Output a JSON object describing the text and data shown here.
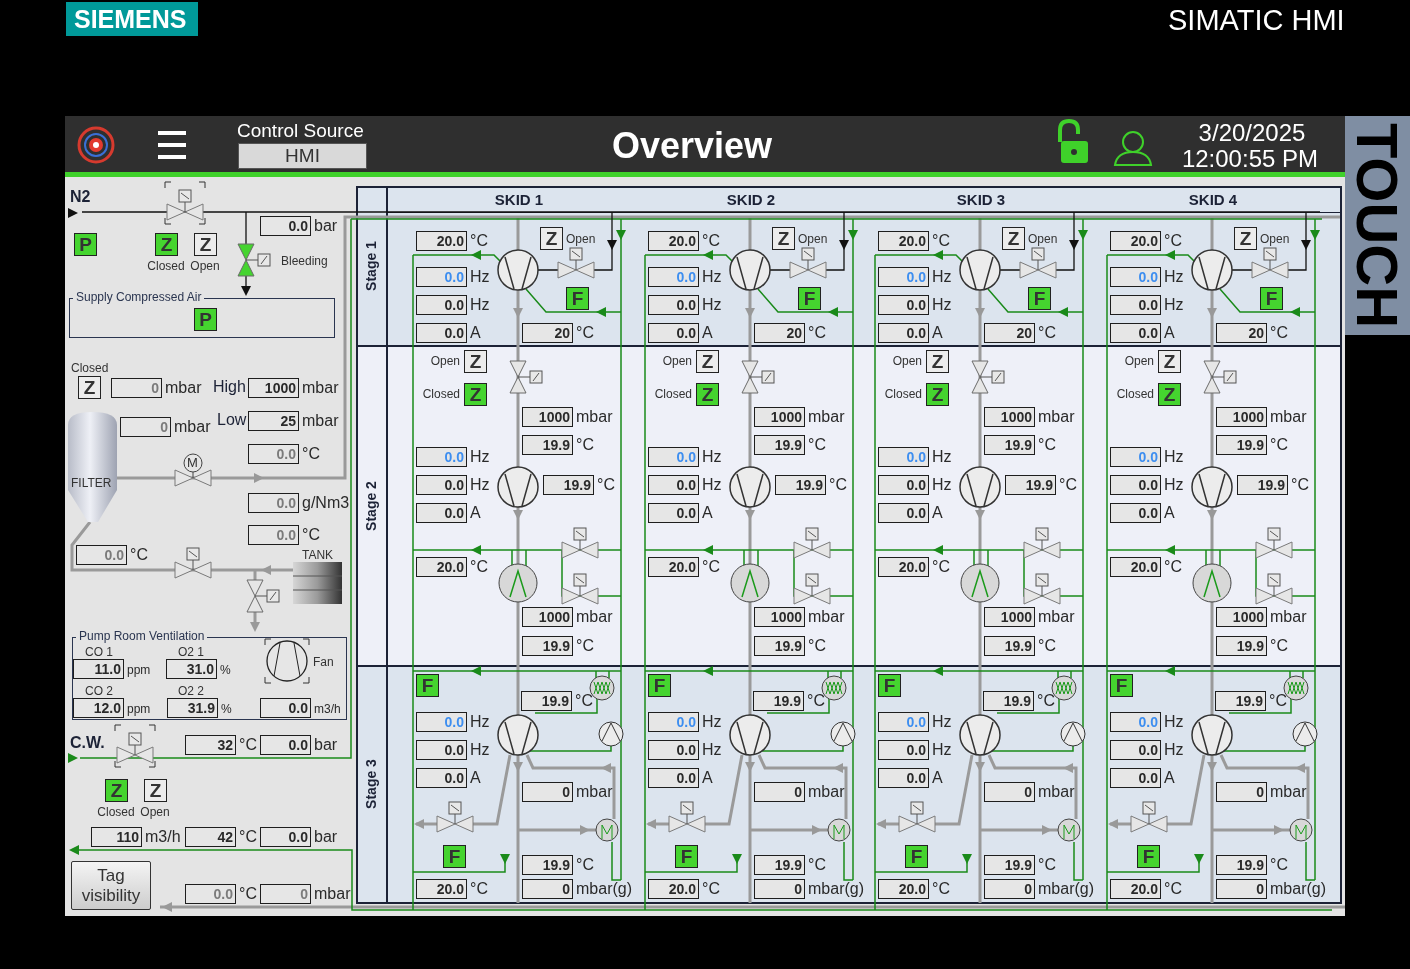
{
  "header": {
    "brand": "SIEMENS",
    "product": "SIMATIC HMI",
    "side_label": "TOUCH",
    "control_source_label": "Control Source",
    "control_source_value": "HMI",
    "title": "Overview",
    "date": "3/20/2025",
    "time": "12:00:55 PM"
  },
  "left_panel": [
    {
      "kind": "text",
      "text": "N2"
    },
    {
      "kind": "indicator",
      "letter": "P",
      "on": true
    },
    {
      "kind": "indicator",
      "letter": "Z",
      "on": true,
      "label": "Closed"
    },
    {
      "kind": "indicator",
      "letter": "Z",
      "on": false,
      "label": "Open"
    },
    {
      "kind": "field",
      "value": "0.0",
      "unit": "bar"
    },
    {
      "kind": "text",
      "text": "Bleeding"
    },
    {
      "kind": "group",
      "text": "Supply Compressed Air"
    },
    {
      "kind": "indicator",
      "letter": "P",
      "on": true
    },
    {
      "kind": "text",
      "text": "Closed"
    },
    {
      "kind": "indicator",
      "letter": "Z",
      "on": false
    },
    {
      "kind": "inactive",
      "value": "0",
      "unit": "mbar"
    },
    {
      "kind": "text",
      "text": "High"
    },
    {
      "kind": "field",
      "value": "1000",
      "unit": "mbar"
    },
    {
      "kind": "inactive",
      "value": "0",
      "unit": "mbar"
    },
    {
      "kind": "text",
      "text": "Low"
    },
    {
      "kind": "field",
      "value": "25",
      "unit": "mbar"
    },
    {
      "kind": "inactive",
      "value": "0.0",
      "unit": "°C"
    },
    {
      "kind": "text",
      "text": "M"
    },
    {
      "kind": "text",
      "text": "FILTER"
    },
    {
      "kind": "inactive",
      "value": "0.0",
      "unit": "g/Nm3"
    },
    {
      "kind": "inactive",
      "value": "0.0",
      "unit": "°C"
    },
    {
      "kind": "inactive",
      "value": "0.0",
      "unit": "°C"
    },
    {
      "kind": "text",
      "text": "TANK"
    },
    {
      "kind": "group",
      "text": "Pump Room Ventilation"
    },
    {
      "kind": "text",
      "text": "CO 1"
    },
    {
      "kind": "text",
      "text": "O2 1"
    },
    {
      "kind": "field",
      "value": "11.0",
      "unit": "ppm"
    },
    {
      "kind": "field",
      "value": "31.0",
      "unit": "%"
    },
    {
      "kind": "text",
      "text": "Fan"
    },
    {
      "kind": "text",
      "text": "CO 2"
    },
    {
      "kind": "text",
      "text": "O2 2"
    },
    {
      "kind": "field",
      "value": "12.0",
      "unit": "ppm"
    },
    {
      "kind": "field",
      "value": "31.9",
      "unit": "%"
    },
    {
      "kind": "field",
      "value": "0.0",
      "unit": "m3/h"
    },
    {
      "kind": "text",
      "text": "C.W."
    },
    {
      "kind": "field",
      "value": "32",
      "unit": "°C"
    },
    {
      "kind": "field",
      "value": "0.0",
      "unit": "bar"
    },
    {
      "kind": "indicator",
      "letter": "Z",
      "on": true,
      "label": "Closed"
    },
    {
      "kind": "indicator",
      "letter": "Z",
      "on": false,
      "label": "Open"
    },
    {
      "kind": "field",
      "value": "110",
      "unit": "m3/h"
    },
    {
      "kind": "field",
      "value": "42",
      "unit": "°C"
    },
    {
      "kind": "field",
      "value": "0.0",
      "unit": "bar"
    },
    {
      "kind": "button",
      "text": "Tag visibility"
    },
    {
      "kind": "inactive",
      "value": "0.0",
      "unit": "°C"
    },
    {
      "kind": "inactive",
      "value": "0",
      "unit": "mbar"
    }
  ],
  "bleeding_valve": {
    "on": true
  },
  "stages": [
    "Stage 1",
    "Stage 2",
    "Stage 3"
  ],
  "skids": [
    {
      "title": "SKID 1",
      "stage_1": [
        {
          "kind": "field",
          "value": "20.0",
          "unit": "°C"
        },
        {
          "kind": "indicator",
          "letter": "Z",
          "on": false,
          "label": "Open"
        },
        {
          "kind": "setpoint",
          "value": "0.0",
          "unit": "Hz"
        },
        {
          "kind": "field",
          "value": "0.0",
          "unit": "Hz"
        },
        {
          "kind": "indicator",
          "letter": "F",
          "on": true
        },
        {
          "kind": "field",
          "value": "0.0",
          "unit": "A"
        },
        {
          "kind": "field",
          "value": "20",
          "unit": "°C"
        }
      ],
      "stage_2": [
        {
          "kind": "indicator",
          "letter": "Z",
          "on": false,
          "label": "Open"
        },
        {
          "kind": "indicator",
          "letter": "Z",
          "on": true,
          "label": "Closed"
        },
        {
          "kind": "field",
          "value": "1000",
          "unit": "mbar"
        },
        {
          "kind": "field",
          "value": "19.9",
          "unit": "°C"
        },
        {
          "kind": "setpoint",
          "value": "0.0",
          "unit": "Hz"
        },
        {
          "kind": "field",
          "value": "0.0",
          "unit": "Hz"
        },
        {
          "kind": "field",
          "value": "0.0",
          "unit": "A"
        },
        {
          "kind": "field",
          "value": "19.9",
          "unit": "°C"
        },
        {
          "kind": "field",
          "value": "20.0",
          "unit": "°C"
        },
        {
          "kind": "field",
          "value": "1000",
          "unit": "mbar"
        },
        {
          "kind": "field",
          "value": "19.9",
          "unit": "°C"
        }
      ],
      "stage_3": [
        {
          "kind": "indicator",
          "letter": "F",
          "on": true
        },
        {
          "kind": "field",
          "value": "19.9",
          "unit": "°C"
        },
        {
          "kind": "setpoint",
          "value": "0.0",
          "unit": "Hz"
        },
        {
          "kind": "field",
          "value": "0.0",
          "unit": "Hz"
        },
        {
          "kind": "field",
          "value": "0.0",
          "unit": "A"
        },
        {
          "kind": "field",
          "value": "0",
          "unit": "mbar"
        },
        {
          "kind": "indicator",
          "letter": "F",
          "on": true
        },
        {
          "kind": "field",
          "value": "19.9",
          "unit": "°C"
        },
        {
          "kind": "field",
          "value": "20.0",
          "unit": "°C"
        },
        {
          "kind": "field",
          "value": "0",
          "unit": "mbar(g)"
        }
      ]
    },
    {
      "title": "SKID 2",
      "stage_1": [
        {
          "kind": "field",
          "value": "20.0",
          "unit": "°C"
        },
        {
          "kind": "indicator",
          "letter": "Z",
          "on": false,
          "label": "Open"
        },
        {
          "kind": "setpoint",
          "value": "0.0",
          "unit": "Hz"
        },
        {
          "kind": "field",
          "value": "0.0",
          "unit": "Hz"
        },
        {
          "kind": "indicator",
          "letter": "F",
          "on": true
        },
        {
          "kind": "field",
          "value": "0.0",
          "unit": "A"
        },
        {
          "kind": "field",
          "value": "20",
          "unit": "°C"
        }
      ],
      "stage_2": [
        {
          "kind": "indicator",
          "letter": "Z",
          "on": false,
          "label": "Open"
        },
        {
          "kind": "indicator",
          "letter": "Z",
          "on": true,
          "label": "Closed"
        },
        {
          "kind": "field",
          "value": "1000",
          "unit": "mbar"
        },
        {
          "kind": "field",
          "value": "19.9",
          "unit": "°C"
        },
        {
          "kind": "setpoint",
          "value": "0.0",
          "unit": "Hz"
        },
        {
          "kind": "field",
          "value": "0.0",
          "unit": "Hz"
        },
        {
          "kind": "field",
          "value": "0.0",
          "unit": "A"
        },
        {
          "kind": "field",
          "value": "19.9",
          "unit": "°C"
        },
        {
          "kind": "field",
          "value": "20.0",
          "unit": "°C"
        },
        {
          "kind": "field",
          "value": "1000",
          "unit": "mbar"
        },
        {
          "kind": "field",
          "value": "19.9",
          "unit": "°C"
        }
      ],
      "stage_3": [
        {
          "kind": "indicator",
          "letter": "F",
          "on": true
        },
        {
          "kind": "field",
          "value": "19.9",
          "unit": "°C"
        },
        {
          "kind": "setpoint",
          "value": "0.0",
          "unit": "Hz"
        },
        {
          "kind": "field",
          "value": "0.0",
          "unit": "Hz"
        },
        {
          "kind": "field",
          "value": "0.0",
          "unit": "A"
        },
        {
          "kind": "field",
          "value": "0",
          "unit": "mbar"
        },
        {
          "kind": "indicator",
          "letter": "F",
          "on": true
        },
        {
          "kind": "field",
          "value": "19.9",
          "unit": "°C"
        },
        {
          "kind": "field",
          "value": "20.0",
          "unit": "°C"
        },
        {
          "kind": "field",
          "value": "0",
          "unit": "mbar(g)"
        }
      ]
    },
    {
      "title": "SKID 3",
      "stage_1": [
        {
          "kind": "field",
          "value": "20.0",
          "unit": "°C"
        },
        {
          "kind": "indicator",
          "letter": "Z",
          "on": false,
          "label": "Open"
        },
        {
          "kind": "setpoint",
          "value": "0.0",
          "unit": "Hz"
        },
        {
          "kind": "field",
          "value": "0.0",
          "unit": "Hz"
        },
        {
          "kind": "indicator",
          "letter": "F",
          "on": true
        },
        {
          "kind": "field",
          "value": "0.0",
          "unit": "A"
        },
        {
          "kind": "field",
          "value": "20",
          "unit": "°C"
        }
      ],
      "stage_2": [
        {
          "kind": "indicator",
          "letter": "Z",
          "on": false,
          "label": "Open"
        },
        {
          "kind": "indicator",
          "letter": "Z",
          "on": true,
          "label": "Closed"
        },
        {
          "kind": "field",
          "value": "1000",
          "unit": "mbar"
        },
        {
          "kind": "field",
          "value": "19.9",
          "unit": "°C"
        },
        {
          "kind": "setpoint",
          "value": "0.0",
          "unit": "Hz"
        },
        {
          "kind": "field",
          "value": "0.0",
          "unit": "Hz"
        },
        {
          "kind": "field",
          "value": "0.0",
          "unit": "A"
        },
        {
          "kind": "field",
          "value": "19.9",
          "unit": "°C"
        },
        {
          "kind": "field",
          "value": "20.0",
          "unit": "°C"
        },
        {
          "kind": "field",
          "value": "1000",
          "unit": "mbar"
        },
        {
          "kind": "field",
          "value": "19.9",
          "unit": "°C"
        }
      ],
      "stage_3": [
        {
          "kind": "indicator",
          "letter": "F",
          "on": true
        },
        {
          "kind": "field",
          "value": "19.9",
          "unit": "°C"
        },
        {
          "kind": "setpoint",
          "value": "0.0",
          "unit": "Hz"
        },
        {
          "kind": "field",
          "value": "0.0",
          "unit": "Hz"
        },
        {
          "kind": "field",
          "value": "0.0",
          "unit": "A"
        },
        {
          "kind": "field",
          "value": "0",
          "unit": "mbar"
        },
        {
          "kind": "indicator",
          "letter": "F",
          "on": true
        },
        {
          "kind": "field",
          "value": "19.9",
          "unit": "°C"
        },
        {
          "kind": "field",
          "value": "20.0",
          "unit": "°C"
        },
        {
          "kind": "field",
          "value": "0",
          "unit": "mbar(g)"
        }
      ]
    },
    {
      "title": "SKID 4",
      "stage_1": [
        {
          "kind": "field",
          "value": "20.0",
          "unit": "°C"
        },
        {
          "kind": "indicator",
          "letter": "Z",
          "on": false,
          "label": "Open"
        },
        {
          "kind": "setpoint",
          "value": "0.0",
          "unit": "Hz"
        },
        {
          "kind": "field",
          "value": "0.0",
          "unit": "Hz"
        },
        {
          "kind": "indicator",
          "letter": "F",
          "on": true
        },
        {
          "kind": "field",
          "value": "0.0",
          "unit": "A"
        },
        {
          "kind": "field",
          "value": "20",
          "unit": "°C"
        }
      ],
      "stage_2": [
        {
          "kind": "indicator",
          "letter": "Z",
          "on": false,
          "label": "Open"
        },
        {
          "kind": "indicator",
          "letter": "Z",
          "on": true,
          "label": "Closed"
        },
        {
          "kind": "field",
          "value": "1000",
          "unit": "mbar"
        },
        {
          "kind": "field",
          "value": "19.9",
          "unit": "°C"
        },
        {
          "kind": "setpoint",
          "value": "0.0",
          "unit": "Hz"
        },
        {
          "kind": "field",
          "value": "0.0",
          "unit": "Hz"
        },
        {
          "kind": "field",
          "value": "0.0",
          "unit": "A"
        },
        {
          "kind": "field",
          "value": "19.9",
          "unit": "°C"
        },
        {
          "kind": "field",
          "value": "20.0",
          "unit": "°C"
        },
        {
          "kind": "field",
          "value": "1000",
          "unit": "mbar"
        },
        {
          "kind": "field",
          "value": "19.9",
          "unit": "°C"
        }
      ],
      "stage_3": [
        {
          "kind": "indicator",
          "letter": "F",
          "on": true
        },
        {
          "kind": "field",
          "value": "19.9",
          "unit": "°C"
        },
        {
          "kind": "setpoint",
          "value": "0.0",
          "unit": "Hz"
        },
        {
          "kind": "field",
          "value": "0.0",
          "unit": "Hz"
        },
        {
          "kind": "field",
          "value": "0.0",
          "unit": "A"
        },
        {
          "kind": "field",
          "value": "0",
          "unit": "mbar"
        },
        {
          "kind": "indicator",
          "letter": "F",
          "on": true
        },
        {
          "kind": "field",
          "value": "19.9",
          "unit": "°C"
        },
        {
          "kind": "field",
          "value": "20.0",
          "unit": "°C"
        },
        {
          "kind": "field",
          "value": "0",
          "unit": "mbar(g)"
        }
      ]
    }
  ]
}
